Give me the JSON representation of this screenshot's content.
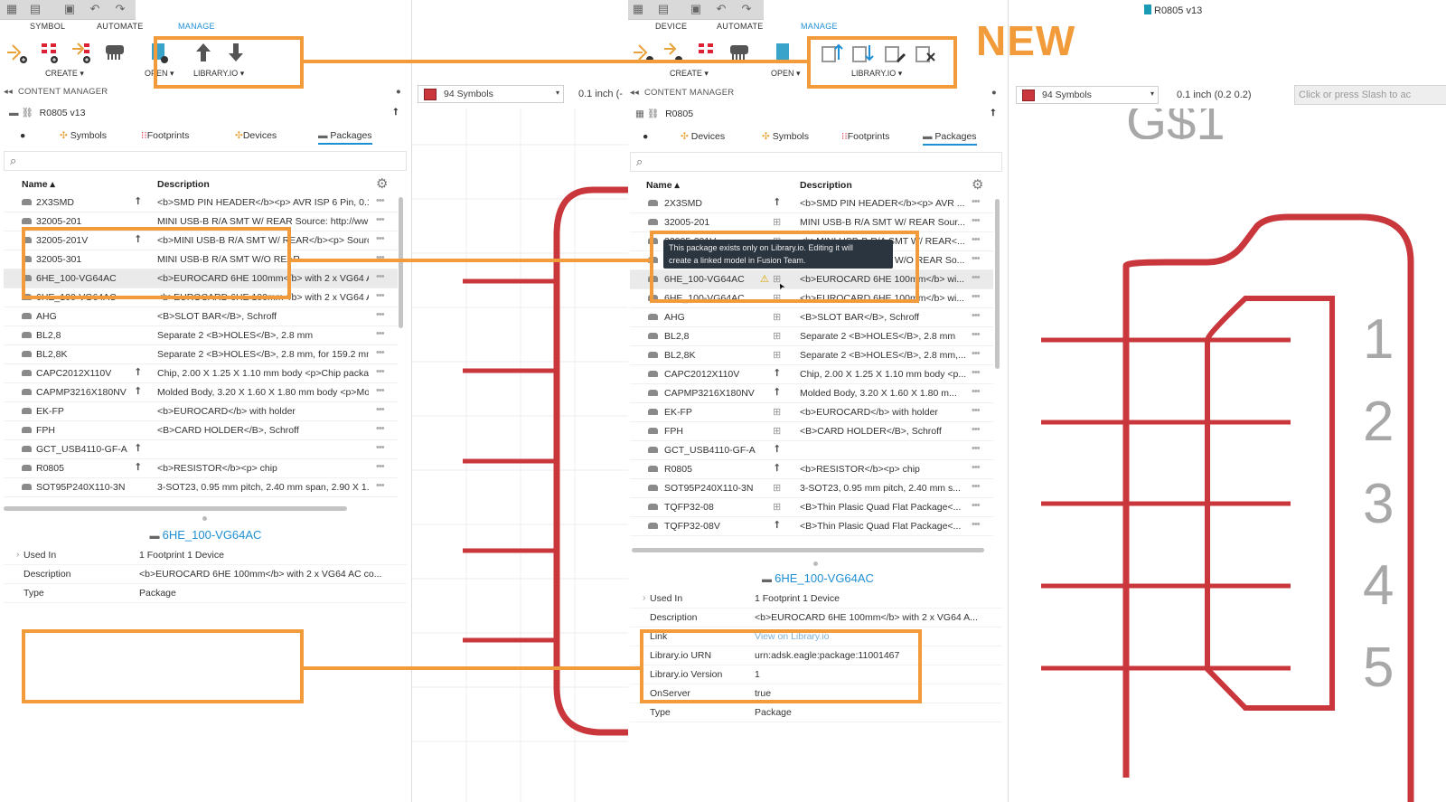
{
  "left": {
    "ribbon_tabs": [
      "SYMBOL",
      "AUTOMATE",
      "MANAGE"
    ],
    "groups": {
      "create": "CREATE ▾",
      "open": "OPEN ▾",
      "library_io": "LIBRARY.IO ▾"
    },
    "content_manager": "CONTENT MANAGER",
    "library_name": "R0805 v13",
    "lib_tabs": [
      "Symbols",
      "Footprints",
      "Devices",
      "Packages"
    ],
    "col_name": "Name ▴",
    "col_desc": "Description",
    "rows": [
      {
        "name": "2X3SMD",
        "desc": "<b>SMD PIN HEADER</b><p> AVR ISP 6 Pin, 0.1\"",
        "up": true
      },
      {
        "name": "32005-201",
        "desc": "MINI USB-B R/A SMT W/ REAR Source: http://ww",
        "up": false
      },
      {
        "name": "32005-201V",
        "desc": "<b>MINI USB-B R/A SMT W/ REAR</b><p> Sourc",
        "up": true
      },
      {
        "name": "32005-301",
        "desc": "MINI USB-B R/A SMT W/O REAR",
        "up": false
      },
      {
        "name": "6HE_100-VG64AC",
        "desc": "<b>EUROCARD 6HE 100mm</b> with 2 x VG64 AC",
        "up": false
      },
      {
        "name": "6HE_100-VG64AC",
        "desc": "<b>EUROCARD 6HE 100mm</b> with 2 x VG64 AC",
        "up": false
      },
      {
        "name": "AHG",
        "desc": "<B>SLOT BAR</B>, Schroff",
        "up": false
      },
      {
        "name": "BL2,8",
        "desc": "Separate 2 <B>HOLES</B>, 2.8 mm",
        "up": false
      },
      {
        "name": "BL2,8K",
        "desc": "Separate 2 <B>HOLES</B>, 2.8 mm, for 159.2 mm",
        "up": false
      },
      {
        "name": "CAPC2012X110V",
        "desc": "Chip, 2.00 X 1.25 X 1.10 mm body <p>Chip package",
        "up": true
      },
      {
        "name": "CAPMP3216X180NV",
        "desc": "Molded Body, 3.20 X 1.60 X 1.80 mm body <p>Mol",
        "up": true
      },
      {
        "name": "EK-FP",
        "desc": "<b>EUROCARD</b> with holder",
        "up": false
      },
      {
        "name": "FPH",
        "desc": "<B>CARD HOLDER</B>, Schroff",
        "up": false
      },
      {
        "name": "GCT_USB4110-GF-A",
        "desc": "",
        "up": true
      },
      {
        "name": "R0805",
        "desc": "<b>RESISTOR</b><p> chip",
        "up": true
      },
      {
        "name": "SOT95P240X110-3N",
        "desc": "3-SOT23, 0.95 mm pitch, 2.40 mm span, 2.90 X 1.3",
        "up": false
      }
    ],
    "detail_title": "6HE_100-VG64AC",
    "props": [
      {
        "k": "Used In",
        "v": "1 Footprint 1 Device"
      },
      {
        "k": "Description",
        "v": "<b>EUROCARD 6HE 100mm</b> with 2 x VG64 AC co..."
      },
      {
        "k": "Type",
        "v": "Package"
      }
    ]
  },
  "middle": {
    "dropdown": "94 Symbols",
    "grid": "0.1 inch (-"
  },
  "right": {
    "title": "R0805 v13",
    "badge": "NEW",
    "ribbon_tabs": [
      "DEVICE",
      "AUTOMATE",
      "MANAGE"
    ],
    "groups": {
      "create": "CREATE ▾",
      "open": "OPEN ▾",
      "library_io": "LIBRARY.IO ▾"
    },
    "content_manager": "CONTENT MANAGER",
    "library_name": "R0805",
    "lib_tabs": [
      "Devices",
      "Symbols",
      "Footprints",
      "Packages"
    ],
    "col_name": "Name ▴",
    "col_desc": "Description",
    "tooltip": [
      "This package exists only on Library.io. Editing it will",
      "create a linked model in Fusion Team."
    ],
    "rows": [
      {
        "name": "2X3SMD",
        "desc": "<b>SMD PIN HEADER</b><p> AVR ...",
        "ico": "up"
      },
      {
        "name": "32005-201",
        "desc": "MINI USB-B R/A SMT W/ REAR Sour...",
        "ico": "lib"
      },
      {
        "name": "32005-201V",
        "desc": "<b>MINI USB-B R/A SMT W/ REAR<...",
        "ico": "lib"
      },
      {
        "name": "32005-301",
        "desc": "MINI USB-B R/A SMT W/O REAR So...",
        "ico": "lib"
      },
      {
        "name": "6HE_100-VG64AC",
        "desc": "<b>EUROCARD 6HE 100mm</b> wi...",
        "ico": "warn"
      },
      {
        "name": "6HE_100-VG64AC",
        "desc": "<b>EUROCARD 6HE 100mm</b> wi...",
        "ico": "lib"
      },
      {
        "name": "AHG",
        "desc": "<B>SLOT BAR</B>, Schroff",
        "ico": "lib"
      },
      {
        "name": "BL2,8",
        "desc": "Separate 2 <B>HOLES</B>, 2.8 mm",
        "ico": "lib"
      },
      {
        "name": "BL2,8K",
        "desc": "Separate 2 <B>HOLES</B>, 2.8 mm,...",
        "ico": "lib"
      },
      {
        "name": "CAPC2012X110V",
        "desc": "Chip, 2.00 X 1.25 X 1.10 mm body <p...",
        "ico": "up"
      },
      {
        "name": "CAPMP3216X180NV",
        "desc": "Molded Body, 3.20 X 1.60 X 1.80 m...",
        "ico": "up"
      },
      {
        "name": "EK-FP",
        "desc": "<b>EUROCARD</b> with holder",
        "ico": "lib"
      },
      {
        "name": "FPH",
        "desc": "<B>CARD HOLDER</B>, Schroff",
        "ico": "lib"
      },
      {
        "name": "GCT_USB4110-GF-A",
        "desc": "",
        "ico": "up"
      },
      {
        "name": "R0805",
        "desc": "<b>RESISTOR</b><p> chip",
        "ico": "up"
      },
      {
        "name": "SOT95P240X110-3N",
        "desc": "3-SOT23, 0.95 mm pitch, 2.40 mm s...",
        "ico": "lib"
      },
      {
        "name": "TQFP32-08",
        "desc": "<B>Thin Plasic Quad Flat Package<...",
        "ico": "lib"
      },
      {
        "name": "TQFP32-08V",
        "desc": "<B>Thin Plasic Quad Flat Package<...",
        "ico": "up"
      }
    ],
    "detail_title": "6HE_100-VG64AC",
    "props": [
      {
        "k": "Used In",
        "v": "1 Footprint 1 Device"
      },
      {
        "k": "Description",
        "v": "<b>EUROCARD 6HE 100mm</b> with 2 x VG64 A..."
      },
      {
        "k": "Link",
        "v": "View on Library.io"
      },
      {
        "k": "Library.io URN",
        "v": "urn:adsk.eagle:package:11001467"
      },
      {
        "k": "Library.io Version",
        "v": "1"
      },
      {
        "k": "OnServer",
        "v": "true"
      },
      {
        "k": "Type",
        "v": "Package"
      }
    ],
    "dropdown": "94 Symbols",
    "grid": "0.1 inch (0.2 0.2)",
    "search_placeholder": "Click or press Slash to ac",
    "symbol_name": "G$1",
    "pin_numbers": [
      "1",
      "2",
      "3",
      "4",
      "5"
    ]
  },
  "colors": {
    "accent": "#1f8fd3",
    "highlight": "#f29b3a",
    "symbol": "#c9373c"
  }
}
